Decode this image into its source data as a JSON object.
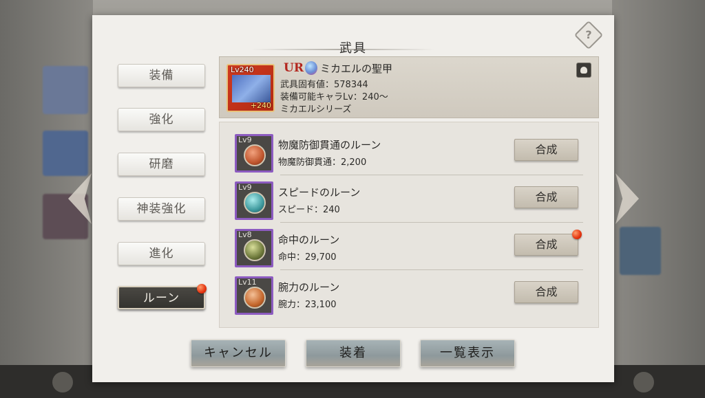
{
  "dialog": {
    "title": "武具"
  },
  "tabs": [
    {
      "label": "装備",
      "active": false,
      "badge": false
    },
    {
      "label": "強化",
      "active": false,
      "badge": false
    },
    {
      "label": "研磨",
      "active": false,
      "badge": false
    },
    {
      "label": "神装強化",
      "active": false,
      "badge": false
    },
    {
      "label": "進化",
      "active": false,
      "badge": false
    },
    {
      "label": "ルーン",
      "active": true,
      "badge": true
    }
  ],
  "item": {
    "level": "Lv240",
    "plus": "+240",
    "rarity": "UR",
    "name": "ミカエルの聖甲",
    "unique_value": "武具固有値：578344",
    "equippable": "装備可能キャラLv：240～",
    "series": "ミカエルシリーズ"
  },
  "runes": [
    {
      "level": "Lv9",
      "name": "物魔防御貫通のルーン",
      "stat": "物魔防御貫通：2,200",
      "button": "合成",
      "badge": false,
      "orb_color": "#c0562e"
    },
    {
      "level": "Lv9",
      "name": "スピードのルーン",
      "stat": "スピード：240",
      "button": "合成",
      "badge": false,
      "orb_color": "#3f9a9e"
    },
    {
      "level": "Lv8",
      "name": "命中のルーン",
      "stat": "命中：29,700",
      "button": "合成",
      "badge": true,
      "orb_color": "#6f7a3c"
    },
    {
      "level": "Lv11",
      "name": "腕力のルーン",
      "stat": "腕力：23,100",
      "button": "合成",
      "badge": false,
      "orb_color": "#c5672c"
    }
  ],
  "actions": {
    "cancel": "キャンセル",
    "equip": "装着",
    "list_view": "一覧表示"
  },
  "colors": {
    "badge": "#e3330f",
    "rarity": "#b3261e",
    "rune_frame": "#8c5bc0"
  }
}
